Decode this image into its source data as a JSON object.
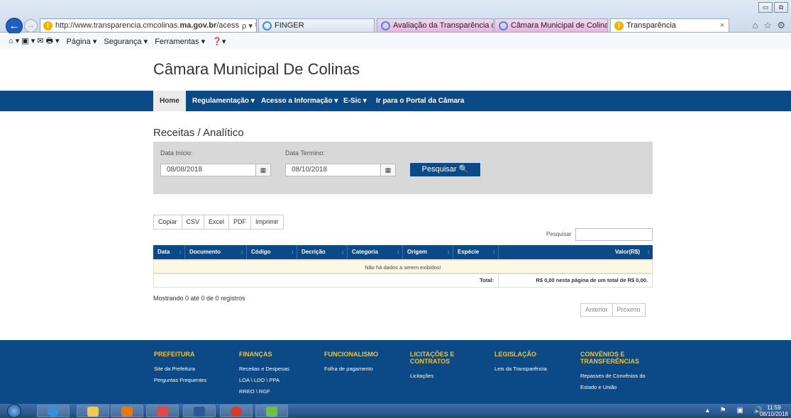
{
  "browser": {
    "url_prefix": "http://www.transparencia.cmcolinas.",
    "url_domain": "ma.gov.br",
    "url_suffix": "/acess",
    "url_tools": "ρ ▾ ↻",
    "finger_tab": "FINGER",
    "tabs": [
      {
        "label": "Avaliação da Transparência do..."
      },
      {
        "label": "Câmara Municipal de Colinas"
      },
      {
        "label": "Transparência",
        "close": "×"
      }
    ],
    "right_icons": "⌂ ☆ ⚙",
    "window_buttons": [
      "▭",
      "⧉",
      "✕"
    ],
    "command_bar": {
      "page": "Página ▾",
      "security": "Segurança ▾",
      "tools": "Ferramentas ▾",
      "help": "❓▾",
      "home_icons": "⌂ ▾  ▣ ▾  ✉  🖶 ▾"
    }
  },
  "site": {
    "title": "Câmara Municipal De Colinas",
    "nav": [
      {
        "label": "Home"
      },
      {
        "label": "Regulamentação ▾"
      },
      {
        "label": "Acesso a Informação ▾"
      },
      {
        "label": "E-Sic ▾"
      },
      {
        "label": "Ir para o Portal da Câmara"
      }
    ]
  },
  "page": {
    "heading": "Receitas / Analítico",
    "filter": {
      "start_label": "Data Início:",
      "start_value": "08/08/2018",
      "end_label": "Data Termino:",
      "end_value": "08/10/2018",
      "calendar_glyph": "▦",
      "search_button": "Pesquisar  🔍"
    },
    "exports": [
      "Copiar",
      "CSV",
      "Excel",
      "PDF",
      "Imprimir"
    ],
    "table_search_label": "Pesquisar",
    "table": {
      "columns": [
        "Data",
        "Documento",
        "Código",
        "Decrição",
        "Categoria",
        "Origem",
        "Espécie",
        "Valor(R$)"
      ],
      "sort_glyph": "↕",
      "empty_message": "Não há dados a serem exibidos!",
      "total_label": "Total:",
      "total_value": "R$ 0,00 nesta página de um total de R$ 0,00."
    },
    "info": "Mostrando 0 até 0 de 0 registros",
    "pager": {
      "prev": "Anterior",
      "next": "Próximo"
    }
  },
  "footer": {
    "columns": [
      {
        "title": "PREFEITURA",
        "links": [
          "Site da Prefeitura",
          "Perguntas Frequentes"
        ]
      },
      {
        "title": "FINANÇAS",
        "links": [
          "Receitas e Despesas",
          "LOA \\ LDO \\ PPA",
          "RREO \\ RGF"
        ]
      },
      {
        "title": "FUNCIONALISMO",
        "links": [
          "Folha de pagamento"
        ]
      },
      {
        "title": "LICITAÇÕES E CONTRATOS",
        "links": [
          "Licitações"
        ]
      },
      {
        "title": "LEGISLAÇÃO",
        "links": [
          "Leis da Transparência"
        ]
      },
      {
        "title": "CONVÊNIOS E TRANSFERÊNCIAS",
        "links": [
          "Repasses de Convênios do",
          "Estado e União"
        ]
      }
    ]
  },
  "taskbar": {
    "time": "11:59",
    "date": "08/10/2018",
    "tray": "▴ ⚑ ▣ 🔊"
  },
  "colors": {
    "brand": "#0b4a86",
    "footer_heading": "#f2c037"
  }
}
